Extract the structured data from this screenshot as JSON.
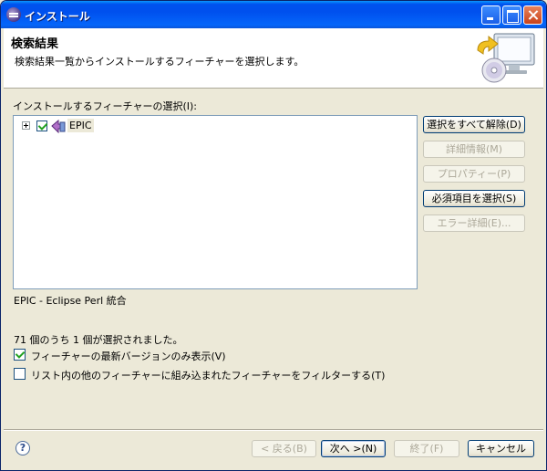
{
  "window": {
    "title": "インストール"
  },
  "banner": {
    "title": "検索結果",
    "description": "検索結果一覧からインストールするフィーチャーを選択します。"
  },
  "features": {
    "label": "インストールするフィーチャーの選択(I):",
    "items": [
      {
        "label": "EPIC",
        "checked": true,
        "expanded": false
      }
    ],
    "description": "EPIC - Eclipse Perl 統合"
  },
  "side_buttons": {
    "deselect_all": "選択をすべて解除(D)",
    "more_info": "詳細情報(M)",
    "properties": "プロパティー(P)",
    "select_required": "必須項目を選択(S)",
    "error_details": "エラー詳細(E)..."
  },
  "status": {
    "selection_count": "71 個のうち 1 個が選択されました。"
  },
  "options": {
    "show_latest": {
      "label": "フィーチャーの最新バージョンのみ表示(V)",
      "checked": true
    },
    "filter_included": {
      "label": "リスト内の他のフィーチャーに組み込まれたフィーチャーをフィルターする(T)",
      "checked": false
    }
  },
  "footer": {
    "help_glyph": "?",
    "back": "< 戻る(B)",
    "next": "次へ >(N)",
    "finish": "終了(F)",
    "cancel": "キャンセル"
  },
  "colors": {
    "titlebar": "#0054e3",
    "dialog_bg": "#ece9d8",
    "check_mark": "#21a121"
  }
}
